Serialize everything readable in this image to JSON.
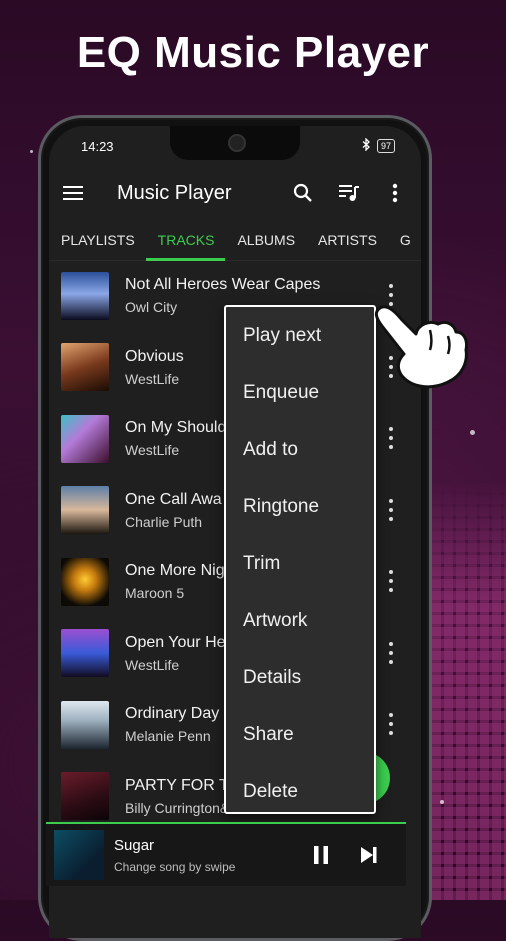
{
  "promo_title": "EQ Music Player",
  "status": {
    "time": "14:23",
    "battery": "97"
  },
  "appbar": {
    "title": "Music Player"
  },
  "tabs": [
    "PLAYLISTS",
    "TRACKS",
    "ALBUMS",
    "ARTISTS",
    "G"
  ],
  "tracks": [
    {
      "title": "Not All Heroes Wear Capes",
      "artist": "Owl City"
    },
    {
      "title": "Obvious",
      "artist": "WestLife"
    },
    {
      "title": "On My Should",
      "artist": "WestLife"
    },
    {
      "title": "One Call Awa",
      "artist": "Charlie Puth"
    },
    {
      "title": "One More Nig",
      "artist": "Maroon 5"
    },
    {
      "title": "Open Your He",
      "artist": "WestLife"
    },
    {
      "title": "Ordinary Day",
      "artist": "Melanie Penn"
    },
    {
      "title": "PARTY FOR T",
      "artist": "Billy Currington&Shania Twain"
    }
  ],
  "menu_items": [
    "Play next",
    "Enqueue",
    "Add to",
    "Ringtone",
    "Trim",
    "Artwork",
    "Details",
    "Share",
    "Delete"
  ],
  "now_playing": {
    "title": "Sugar",
    "subtitle": "Change song by swipe"
  },
  "colors": {
    "accent": "#3ccd4f",
    "background": "#2a0a25",
    "panel": "#1f1f1f"
  }
}
